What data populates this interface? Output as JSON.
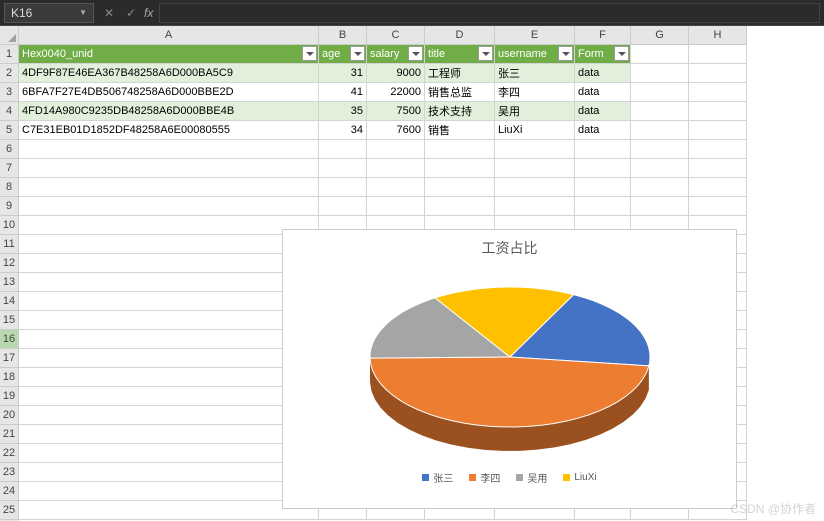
{
  "namebox": "K16",
  "columns": [
    "A",
    "B",
    "C",
    "D",
    "E",
    "F",
    "G",
    "H"
  ],
  "headers": {
    "A": "Hex0040_unid",
    "B": "age",
    "C": "salary",
    "D": "title",
    "E": "username",
    "F": "Form"
  },
  "rows": [
    {
      "A": "4DF9F87E46EA367B48258A6D000BA5C9",
      "B": "31",
      "C": "9000",
      "D": "工程师",
      "E": "张三",
      "F": "data"
    },
    {
      "A": "6BFA7F27E4DB506748258A6D000BBE2D",
      "B": "41",
      "C": "22000",
      "D": "销售总监",
      "E": "李四",
      "F": "data"
    },
    {
      "A": "4FD14A980C9235DB48258A6D000BBE4B",
      "B": "35",
      "C": "7500",
      "D": "技术支持",
      "E": "吴用",
      "F": "data"
    },
    {
      "A": "C7E31EB01D1852DF48258A6E00080555",
      "B": "34",
      "C": "7600",
      "D": "销售",
      "E": "LiuXi",
      "F": "data"
    }
  ],
  "watermark": "CSDN @协作者",
  "chart_data": {
    "type": "pie",
    "title": "工资占比",
    "categories": [
      "张三",
      "李四",
      "吴用",
      "LiuXi"
    ],
    "values": [
      9000,
      22000,
      7500,
      7600
    ],
    "colors": [
      "#4472c4",
      "#ed7d31",
      "#a5a5a5",
      "#ffc000"
    ],
    "legend_position": "bottom"
  }
}
